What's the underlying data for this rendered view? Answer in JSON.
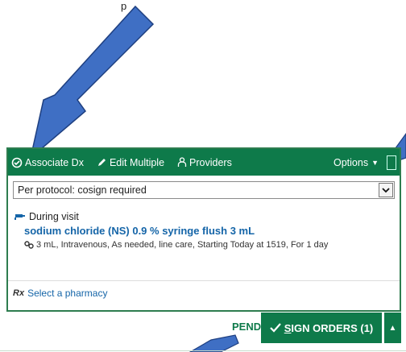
{
  "caption": "p",
  "toolbar": {
    "associate_dx": "Associate Dx",
    "edit_multiple": "Edit Multiple",
    "providers": "Providers",
    "options": "Options"
  },
  "cosign_select": {
    "value": "Per protocol: cosign required"
  },
  "order": {
    "timing": "During visit",
    "medication": "sodium chloride (NS) 0.9 % syringe flush 3 mL",
    "details": "3 mL, Intravenous, As needed, line care, Starting Today at 1519, For 1 day"
  },
  "pharmacy": {
    "rx_symbol": "Rx",
    "label": "Select a pharmacy"
  },
  "footer": {
    "pend_label": "PEND",
    "sign_label_prefix": "S",
    "sign_label_rest": "IGN ORDERS (1)"
  },
  "colors": {
    "accent_green": "#0e7a4a",
    "link_blue": "#1565a8",
    "arrow_blue": "#3f6fc4"
  }
}
